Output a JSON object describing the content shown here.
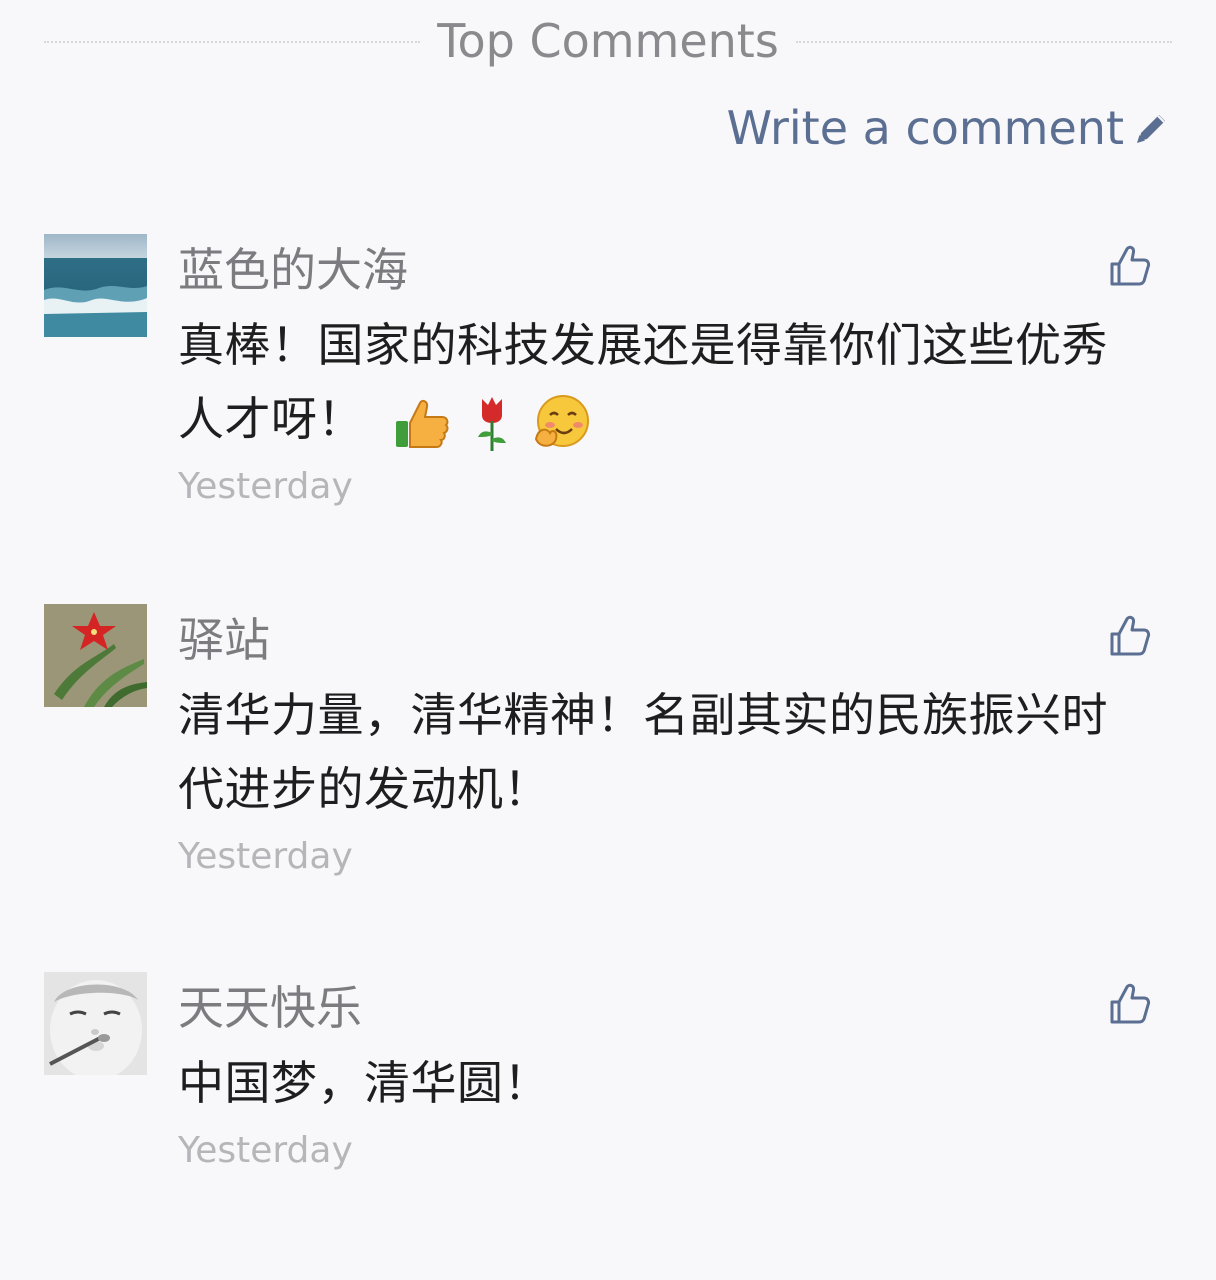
{
  "header": {
    "title": "Top Comments",
    "write_comment_label": "Write a comment"
  },
  "comments": [
    {
      "name": "蓝色的大海",
      "text": "真棒！国家的科技发展还是得靠你们这些优秀人才呀！",
      "time": "Yesterday",
      "emojis": [
        "thumbs-up-emoji",
        "rose-emoji",
        "hugging-face-emoji"
      ]
    },
    {
      "name": "驿站",
      "text": "清华力量，清华精神！名副其实的民族振兴时代进步的发动机！",
      "time": "Yesterday"
    },
    {
      "name": "天天快乐",
      "text": "中国梦，清华圆！",
      "time": "Yesterday"
    }
  ],
  "colors": {
    "background": "#f8f7fa",
    "link": "#5b6f92",
    "name": "#7b7b80",
    "time": "#b6b6ba",
    "text": "#1e1e1e"
  },
  "icons": {
    "write": "pencil-icon",
    "like": "thumbs-up-icon"
  }
}
